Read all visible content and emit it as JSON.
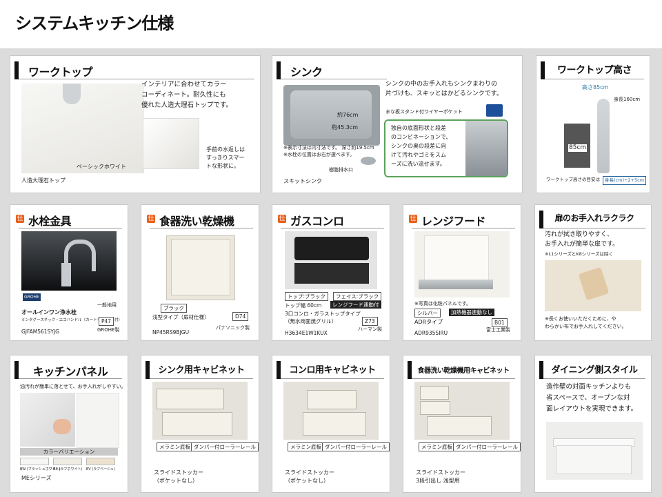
{
  "page": {
    "title": "システムキッチン仕様"
  },
  "worktop": {
    "title": "ワークトップ",
    "desc": [
      "インテリアに合わせてカラー",
      "コーディネート。耐久性にも",
      "優れた人造大理石トップです。"
    ],
    "edge_note": [
      "手前の水返しは",
      "すっきりスマー",
      "トな形状に。"
    ],
    "color_label": "ベーシックホワイト",
    "caption": "人造大理石トップ"
  },
  "sink": {
    "title": "シンク",
    "desc": [
      "シンクの中のお手入れもシンクまわりの",
      "片づけも、スキッとはかどるシンクです。"
    ],
    "dim_w": "約76cm",
    "dim_d": "約45.3cm",
    "stand_label": "まな板スタンド付ワイヤーポケット",
    "notes": [
      "※表示寸法は内寸法です。 深さ約19.5cm",
      "※水栓の位置はお右が選べます。"
    ],
    "drain_label": "樹脂排水口",
    "feature": [
      "独自の底面形状と段差",
      "のコンビネーションで、",
      "シンクの奥の段差に向",
      "けて汚れやゴミをスム",
      "ーズに洗い流せます。"
    ],
    "caption": "スキットシンク"
  },
  "height": {
    "title": "ワークトップ高さ",
    "height_label": "高さ85cm",
    "body_label": "身長160cm",
    "value": "85cm",
    "guide_label": "ワークトップ高さの目安は",
    "guide_formula": "身長(cm)÷2+5cm"
  },
  "faucet": {
    "title": "水栓金具",
    "badge": "GROHE",
    "use_label": "一般地用",
    "name": "オールインワン浄水栓",
    "sub": "ミンタグースネック・エコハンドル（カートリッジ1本付）",
    "code_tag": "P47",
    "model": "GJFAM561SYJG",
    "maker": "GROHE製"
  },
  "dishwasher": {
    "title": "食器洗い乾燥機",
    "color_tag": "ブラック",
    "type": "浅型タイプ（扉材仕様）",
    "code_tag": "D74",
    "model": "NP45RS9BJGU",
    "maker": "パナソニック製"
  },
  "gas": {
    "title": "ガスコンロ",
    "top_tag": "トップ:ブラック",
    "face_tag": "フェイス:ブラック",
    "width_label": "トップ幅 60cm",
    "link_tag": "レンジフード連動付",
    "name": "3口コンロ・ガラストップタイプ",
    "sub": "（無水両面焼グリル）",
    "code_tag": "Z73",
    "model": "H3634E1W1KUX",
    "maker": "ハーマン製"
  },
  "hood": {
    "title": "レンジフード",
    "note": "※写真は化粧パネルです。",
    "color_tag": "シルバー",
    "link_tag": "加熱機器連動なし",
    "type": "ADRタイプ",
    "code_tag": "B01",
    "model": "ADR935SIRU",
    "maker": "富士工業製"
  },
  "door": {
    "title": "扉のお手入れラクラク",
    "desc": [
      "汚れが拭き取りやすく、",
      "お手入れが簡単な扉です。"
    ],
    "exclude": "※L1シリーズとK8シリーズは除く",
    "note": [
      "※長くお使いいただくために、や",
      "わらかい布でお手入れしてください。"
    ]
  },
  "panel": {
    "title": "キッチンパネル",
    "desc": "油汚れが簡単に落とせて、お手入れがしやすい。",
    "variation": "カラーバリエーション",
    "colors": [
      {
        "code": "BW",
        "name": "(ブラッシュホワイト)",
        "hex": "#f6f6f4"
      },
      {
        "code": "BX",
        "name": "(ラフホワイト)",
        "hex": "#efece4"
      },
      {
        "code": "BV",
        "name": "(ラフベージュ)",
        "hex": "#ece2cf"
      }
    ],
    "series": "MEシリーズ"
  },
  "sink_cab": {
    "title": "シンク用キャビネット",
    "tag1": "メラミン底板",
    "tag2": "ダンパー付ローラーレール",
    "caption": [
      "スライドストッカー",
      "（ポケットなし）"
    ]
  },
  "stove_cab": {
    "title": "コンロ用キャビネット",
    "tag1": "メラミン底板",
    "tag2": "ダンパー付ローラーレール",
    "caption": [
      "スライドストッカー",
      "（ポケットなし）"
    ]
  },
  "dw_cab": {
    "title": "食器洗い乾燥機用キャビネット",
    "tag1": "メラミン底板",
    "tag2": "ダンパー付ローラーレール",
    "caption": [
      "スライドストッカー",
      "3段引出し 浅型用"
    ]
  },
  "dining": {
    "title": "ダイニング側スタイル",
    "desc": [
      "造作壁の対面キッチンよりも",
      "省スペースで、オープンな対",
      "面レイアウトを実現できます。"
    ]
  }
}
